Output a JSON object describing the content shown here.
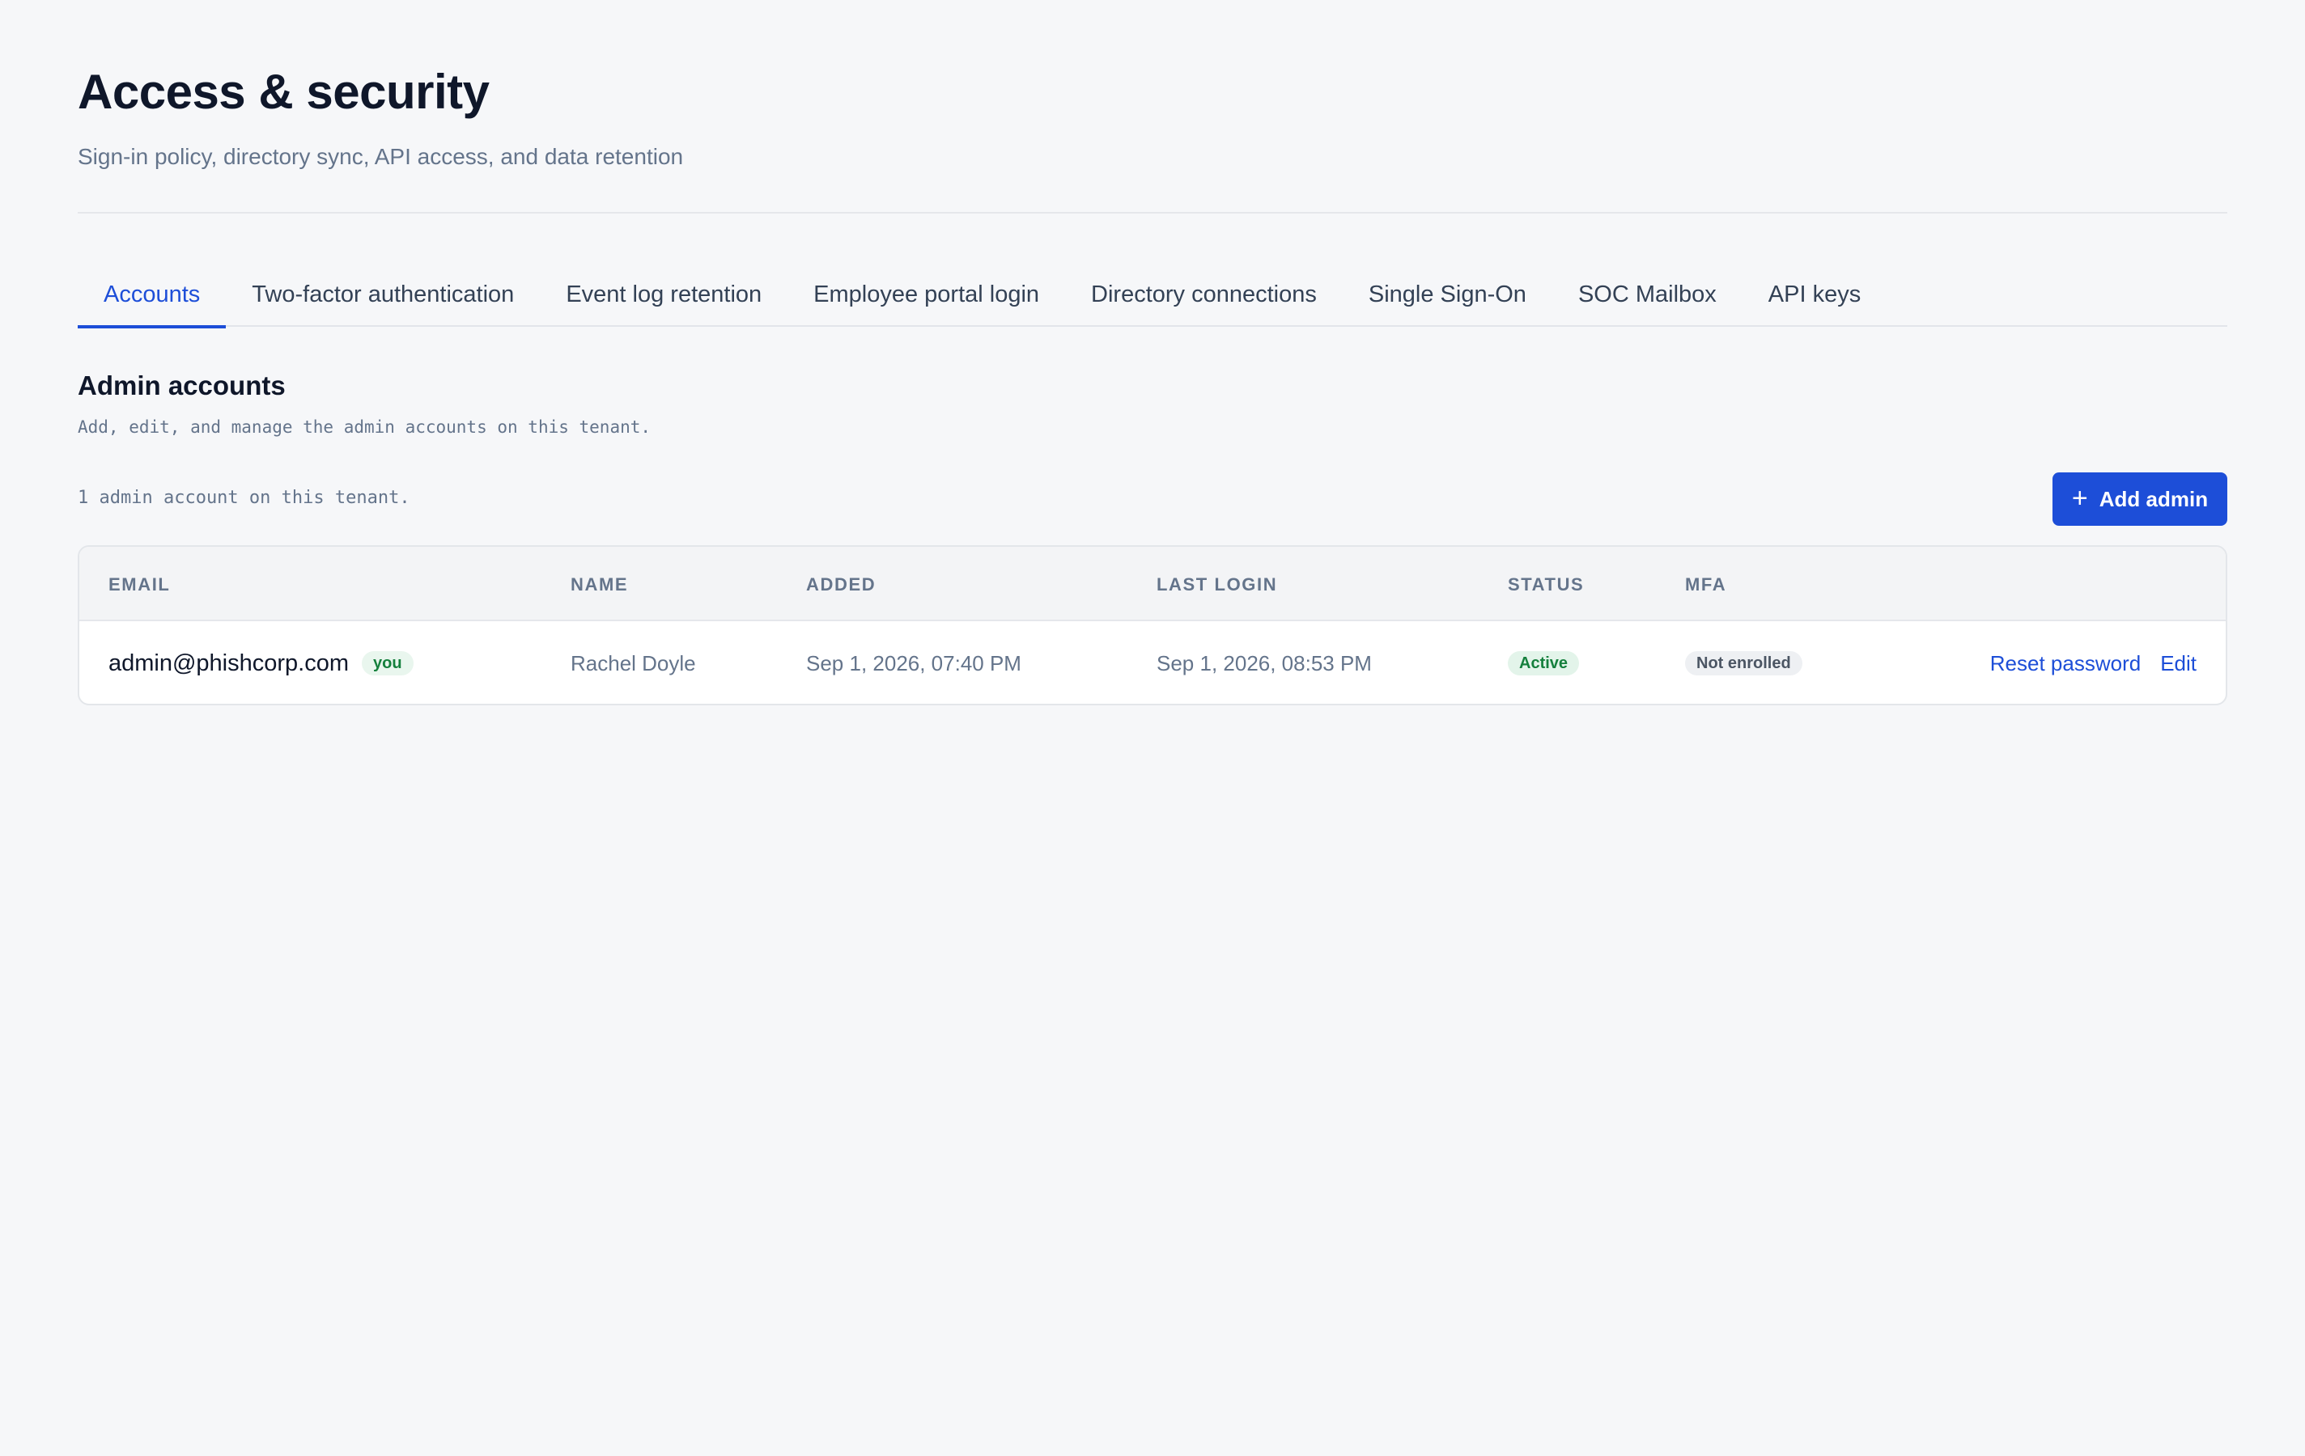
{
  "page": {
    "title": "Access & security",
    "subtitle": "Sign-in policy, directory sync, API access, and data retention"
  },
  "tabs": [
    {
      "label": "Accounts",
      "active": true
    },
    {
      "label": "Two-factor authentication",
      "active": false
    },
    {
      "label": "Event log retention",
      "active": false
    },
    {
      "label": "Employee portal login",
      "active": false
    },
    {
      "label": "Directory connections",
      "active": false
    },
    {
      "label": "Single Sign-On",
      "active": false
    },
    {
      "label": "SOC Mailbox",
      "active": false
    },
    {
      "label": "API keys",
      "active": false
    }
  ],
  "section": {
    "title": "Admin accounts",
    "description": "Add, edit, and manage the admin accounts on this tenant.",
    "count_text": "1 admin account on this tenant.",
    "add_button_label": "Add admin",
    "add_button_icon": "plus-icon"
  },
  "table": {
    "columns": [
      "EMAIL",
      "NAME",
      "ADDED",
      "LAST LOGIN",
      "STATUS",
      "MFA"
    ],
    "rows": [
      {
        "email": "admin@phishcorp.com",
        "you_badge": "you",
        "name": "Rachel Doyle",
        "added": "Sep 1, 2026, 07:40 PM",
        "last_login": "Sep 1, 2026, 08:53 PM",
        "status": "Active",
        "mfa": "Not enrolled",
        "actions": {
          "reset_password": "Reset password",
          "edit": "Edit"
        }
      }
    ]
  },
  "colors": {
    "accent": "#1d4ed8",
    "background": "#f6f7f9",
    "status_active_text": "#15803d",
    "status_active_bg": "#e3f4ea",
    "mfa_badge_bg": "#eef0f3"
  }
}
